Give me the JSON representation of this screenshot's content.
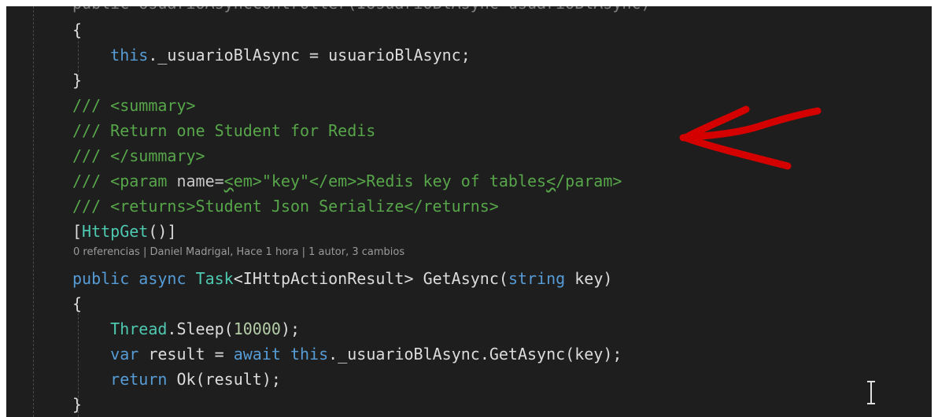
{
  "code": {
    "top_cutoff": "public UsuarioAsyncController(IUsuarioBlAsync usuarioBlAsync)",
    "line1": "{",
    "line2": {
      "indent": "    ",
      "this_kw": "this",
      "rest": "._usuarioBlAsync = usuarioBlAsync;"
    },
    "line3": "}",
    "line4": "/// <summary>",
    "line5": "/// Return one Student for Redis",
    "line6": "/// </summary>",
    "line7": {
      "prefix": "/// <param ",
      "attr": "name",
      "eq": "=",
      "squig1": "<",
      "em_open": "em>\"key\"</em>",
      "text": ">Redis key of tables",
      "squig2": "<",
      "close": "/param>"
    },
    "line8": "/// <returns>Student Json Serialize</returns>",
    "line9": {
      "open": "[",
      "attr": "HttpGet",
      "close": "()]"
    },
    "codelens": "0 referencias | Daniel Madrigal, Hace 1 hora | 1 autor, 3 cambios",
    "line10": {
      "public_kw": "public",
      "async_kw": "async",
      "task_type": "Task",
      "generic": "<IHttpActionResult>",
      "method": "GetAsync(",
      "string_kw": "string",
      "param": "key)"
    },
    "line11": "{",
    "line12": {
      "thread_type": "Thread",
      "rest": ".Sleep(",
      "number": "10000",
      "end": ");"
    },
    "line13": {
      "var_kw": "var",
      "mid": "result =",
      "await_kw": "await",
      "this_kw": "this",
      "rest": "._usuarioBlAsync.GetAsync(key);"
    },
    "line14": {
      "return_kw": "return",
      "rest": "Ok(result);"
    },
    "line15": "}"
  },
  "colors": {
    "background": "#1e1e1e",
    "keyword": "#569cd6",
    "type": "#4ec9b0",
    "comment": "#57a64a",
    "annotation_arrow": "#d40000"
  },
  "icons": [
    "red-arrow-annotation",
    "text-cursor-icon"
  ]
}
